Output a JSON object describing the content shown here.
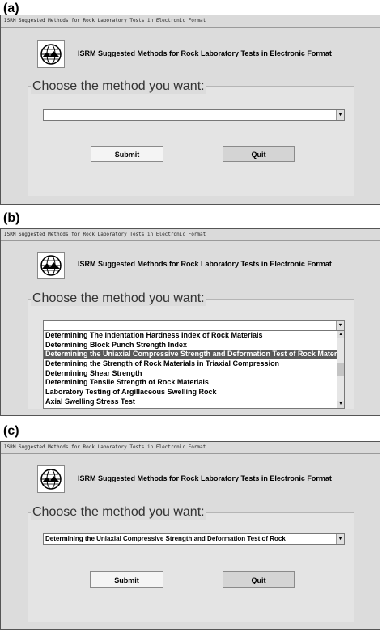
{
  "panels": [
    {
      "label": "(a)"
    },
    {
      "label": "(b)"
    },
    {
      "label": "(c)"
    }
  ],
  "window": {
    "title": "ISRM Suggested Methods for Rock Laboratory Tests in Electronic Format",
    "header_title": "ISRM Suggested Methods for Rock Laboratory Tests in Electronic Format",
    "group_label": "Choose the method you want:",
    "submit_label": "Submit",
    "quit_label": "Quit"
  },
  "panel_a": {
    "selected_value": ""
  },
  "panel_b": {
    "selected_value": "",
    "list_items": [
      "Determining The Indentation Hardness Index of Rock Materials",
      "Determining Block Punch Strength Index",
      "Determining the Uniaxial Compressive Strength and Deformation Test of Rock Materials",
      "Determining the Strength of Rock Materials in Triaxial Compression",
      "Determining Shear Strength",
      "Determining Tensile Strength of Rock Materials",
      "Laboratory Testing of Argillaceous Swelling Rock",
      "Axial Swelling Stress Test"
    ],
    "highlighted_index": 2
  },
  "panel_c": {
    "selected_value": "Determining the Uniaxial Compressive Strength and Deformation Test of Rock"
  },
  "icons": {
    "logo": "isrm-globe-logo",
    "dropdown": "chevron-down-icon",
    "scroll_up": "chevron-up-icon",
    "scroll_down": "chevron-down-icon"
  },
  "colors": {
    "window_bg": "#dcdcdc",
    "selection": "#5a5a5a"
  }
}
